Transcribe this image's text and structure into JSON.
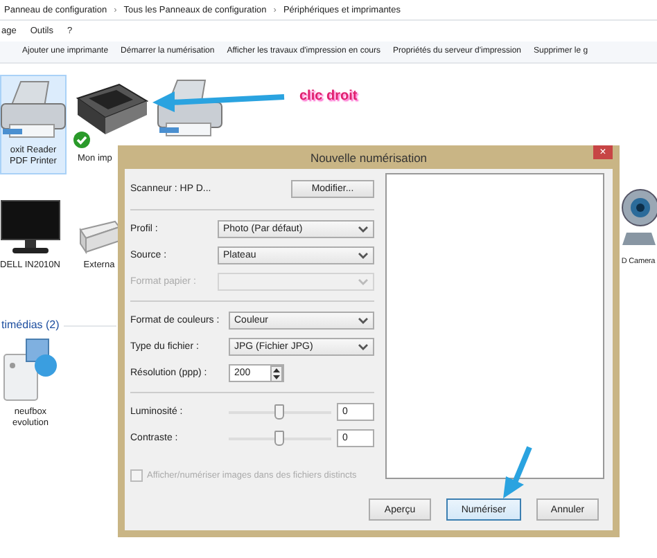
{
  "breadcrumb": [
    {
      "label": "Panneau de configuration"
    },
    {
      "label": "Tous les Panneaux de configuration"
    },
    {
      "label": "Périphériques et imprimantes"
    }
  ],
  "breadcrumb_separator": "›",
  "menu": [
    {
      "label": "age"
    },
    {
      "label": "Outils"
    },
    {
      "label": "?"
    }
  ],
  "toolbar": [
    {
      "label": "Ajouter une imprimante"
    },
    {
      "label": "Démarrer la numérisation"
    },
    {
      "label": "Afficher les travaux d'impression en cours"
    },
    {
      "label": "Propriétés du serveur d'impression"
    },
    {
      "label": "Supprimer le g"
    }
  ],
  "devices": [
    {
      "kind": "printer",
      "label": "oxit Reader PDF Printer",
      "selected": true,
      "default": false
    },
    {
      "kind": "scanner",
      "label": "Mon imp",
      "selected": false,
      "default": true
    },
    {
      "kind": "printer",
      "selected": false,
      "default": false
    },
    {
      "kind": "monitor",
      "label": "DELL IN2010N",
      "selected": false,
      "default": false
    },
    {
      "kind": "drive",
      "label": "Externa",
      "selected": false,
      "default": false
    },
    {
      "kind": "webcam",
      "label": "D Camera",
      "selected": false,
      "default": false
    }
  ],
  "section": {
    "title": "timédias (2)"
  },
  "media_devices": [
    {
      "kind": "mediabox",
      "label": "neufbox evolution"
    }
  ],
  "annotation": {
    "text": "clic droit"
  },
  "dialog": {
    "title": "Nouvelle numérisation",
    "close": "×",
    "scanner": {
      "label": "Scanneur : HP D...",
      "button": "Modifier..."
    },
    "rows": [
      {
        "kind": "select",
        "label": "Profil :",
        "value": "Photo (Par défaut)",
        "disabled": false
      },
      {
        "kind": "select",
        "label": "Source :",
        "value": "Plateau",
        "disabled": false
      },
      {
        "kind": "select",
        "label": "Format papier :",
        "disabled": true
      },
      {
        "kind": "divider"
      },
      {
        "kind": "select",
        "label": "Format de couleurs :",
        "value": "Couleur",
        "disabled": false
      },
      {
        "kind": "select",
        "label": "Type du fichier :",
        "value": "JPG (Fichier JPG)",
        "disabled": false
      },
      {
        "kind": "spinner",
        "label": "Résolution (ppp) :",
        "value": "200"
      },
      {
        "kind": "divider"
      },
      {
        "kind": "slider",
        "label": "Luminosité :",
        "level": 0.5,
        "value": "0"
      },
      {
        "kind": "slider",
        "label": "Contraste :",
        "level": 0.5,
        "value": "0"
      },
      {
        "kind": "checkbox",
        "label": "Afficher/numériser images dans des fichiers distincts",
        "checked": false,
        "disabled": true
      }
    ],
    "buttons": [
      {
        "label": "Aperçu",
        "default": false
      },
      {
        "label": "Numériser",
        "default": true
      },
      {
        "label": "Annuler",
        "default": false
      }
    ]
  }
}
